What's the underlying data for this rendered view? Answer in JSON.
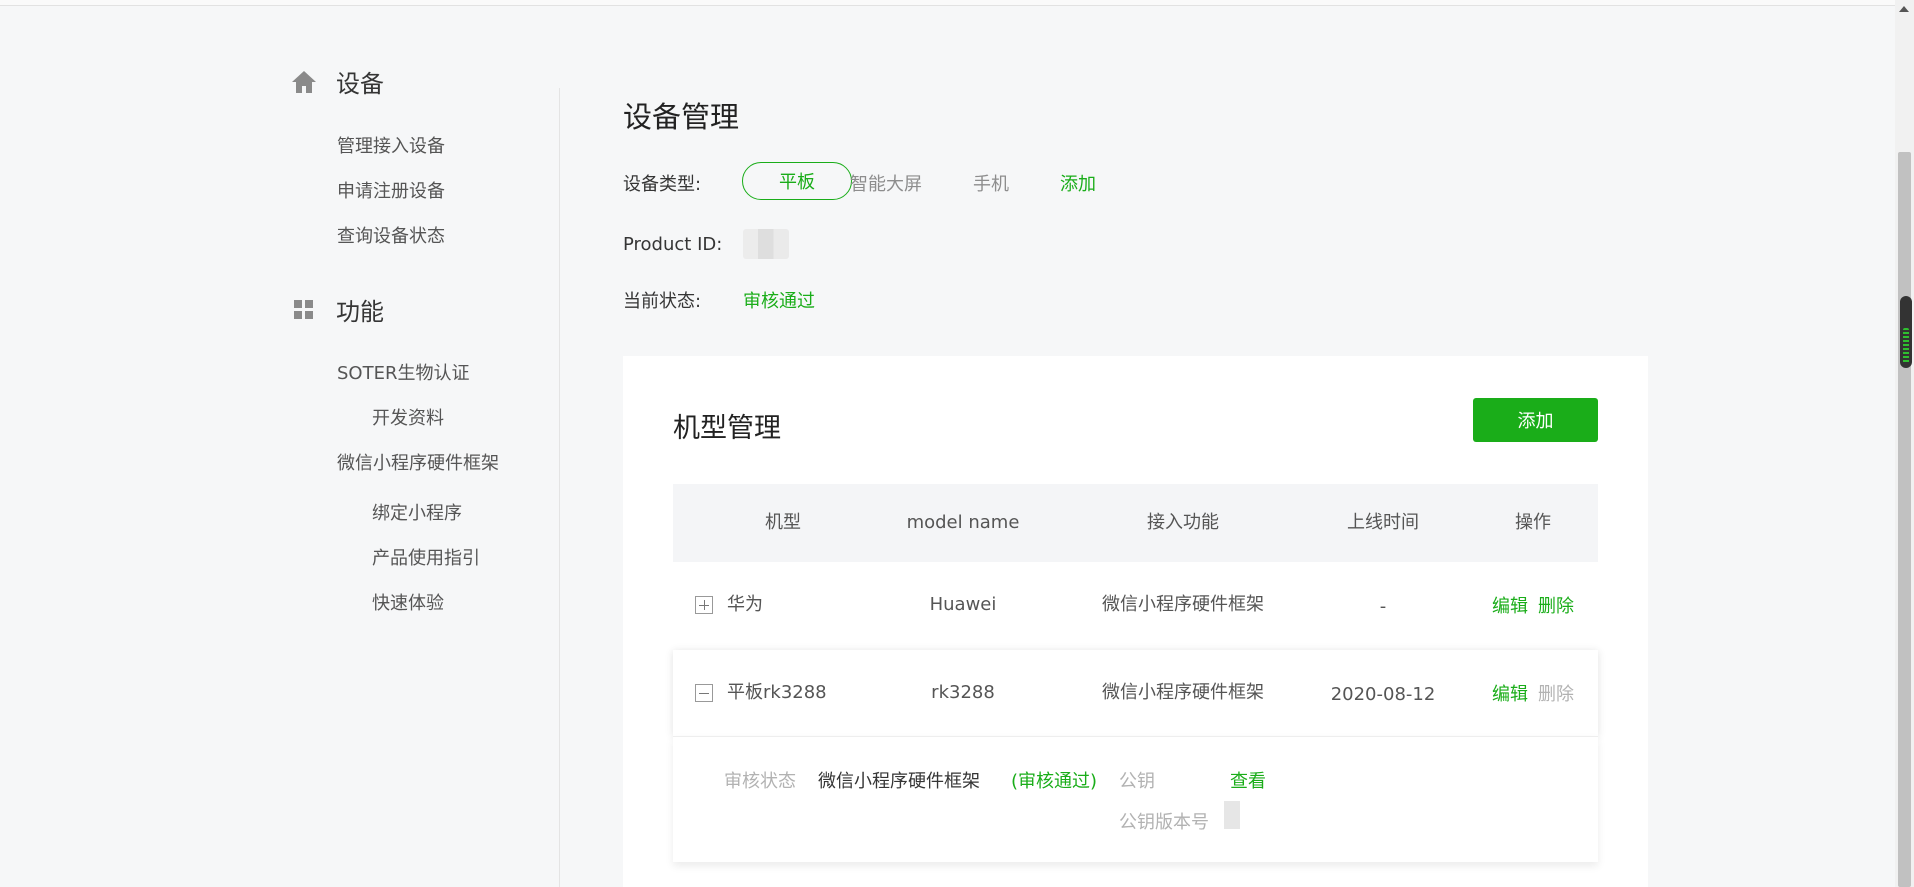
{
  "sidebar": {
    "groups": [
      {
        "title": "设备",
        "icon": "home-icon",
        "items": [
          "管理接入设备",
          "申请注册设备",
          "查询设备状态"
        ]
      },
      {
        "title": "功能",
        "icon": "grid-icon",
        "items": [
          "SOTER生物认证",
          "开发资料",
          "微信小程序硬件框架",
          "绑定小程序",
          "产品使用指引",
          "快速体验"
        ]
      }
    ]
  },
  "main": {
    "title": "设备管理",
    "device_type_label": "设备类型:",
    "device_types": [
      "平板",
      "智能大屏",
      "手机"
    ],
    "device_type_selected": "平板",
    "device_type_add": "添加",
    "product_id_label": "Product ID:",
    "status_label": "当前状态:",
    "status_value": "审核通过"
  },
  "model_card": {
    "title": "机型管理",
    "add_button": "添加",
    "columns": [
      "机型",
      "model name",
      "接入功能",
      "上线时间",
      "操作"
    ],
    "rows": [
      {
        "model": "华为",
        "model_name": "Huawei",
        "feature": "微信小程序硬件框架",
        "online_time": "-",
        "edit": "编辑",
        "delete": "删除",
        "expanded": false
      },
      {
        "model": "平板rk3288",
        "model_name": "rk3288",
        "feature": "微信小程序硬件框架",
        "online_time": "2020-08-12",
        "edit": "编辑",
        "delete": "删除",
        "expanded": true
      }
    ],
    "detail": {
      "review_label": "审核状态",
      "feature": "微信小程序硬件框架",
      "review_status": "(审核通过)",
      "public_key_label": "公钥",
      "view_link": "查看",
      "key_version_label": "公钥版本号"
    }
  },
  "colors": {
    "accent": "#1aad19",
    "background": "#f6f7f8",
    "muted": "#b2b2b2"
  }
}
